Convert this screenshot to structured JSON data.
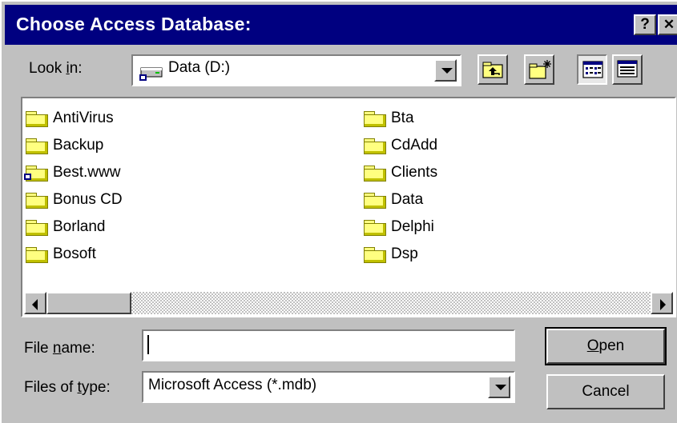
{
  "window": {
    "title": "Choose Access Database:",
    "help_label": "?",
    "close_label": "✕"
  },
  "look_in": {
    "label_pre": "Look ",
    "label_accel": "i",
    "label_post": "n:",
    "value": "Data (D:)"
  },
  "files": {
    "left": [
      {
        "name": "AntiVirus",
        "icon": "folder-icon"
      },
      {
        "name": "Backup",
        "icon": "folder-icon"
      },
      {
        "name": "Best.www",
        "icon": "shared-folder-icon"
      },
      {
        "name": "Bonus CD",
        "icon": "folder-icon"
      },
      {
        "name": "Borland",
        "icon": "folder-icon"
      },
      {
        "name": "Bosoft",
        "icon": "folder-icon"
      }
    ],
    "right": [
      {
        "name": "Bta",
        "icon": "folder-icon"
      },
      {
        "name": "CdAdd",
        "icon": "folder-icon"
      },
      {
        "name": "Clients",
        "icon": "folder-icon"
      },
      {
        "name": "Data",
        "icon": "folder-icon"
      },
      {
        "name": "Delphi",
        "icon": "folder-icon"
      },
      {
        "name": "Dsp",
        "icon": "folder-icon"
      }
    ]
  },
  "file_name": {
    "label_pre": "File ",
    "label_accel": "n",
    "label_post": "ame:",
    "value": ""
  },
  "file_type": {
    "label_pre": "Files of ",
    "label_accel": "t",
    "label_post": "ype:",
    "value": "Microsoft Access (*.mdb)"
  },
  "buttons": {
    "open_accel": "O",
    "open_rest": "pen",
    "cancel": "Cancel"
  },
  "colors": {
    "titlebar": "#000080",
    "face": "#c0c0c0",
    "folder": "#ffff80"
  }
}
